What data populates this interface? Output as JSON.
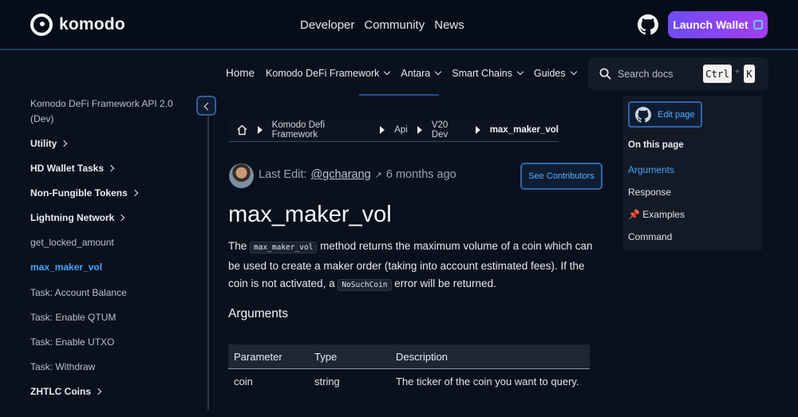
{
  "brand": {
    "name": "komodo"
  },
  "topnav": {
    "items": [
      "Developer",
      "Community",
      "News"
    ]
  },
  "launch_button": {
    "label": "Launch Wallet"
  },
  "docsnav": {
    "items": [
      {
        "label": "Home",
        "dropdown": false
      },
      {
        "label": "Komodo DeFi Framework",
        "dropdown": true
      },
      {
        "label": "Antara",
        "dropdown": true
      },
      {
        "label": "Smart Chains",
        "dropdown": true
      },
      {
        "label": "Guides",
        "dropdown": true
      }
    ]
  },
  "search": {
    "placeholder": "Search docs",
    "shortcut_key1": "Ctrl",
    "shortcut_plus": "+",
    "shortcut_key2": "K"
  },
  "sidebar": {
    "items": [
      {
        "label": "Komodo DeFi Framework API 2.0 (Dev)",
        "style": "normal",
        "expandable": false
      },
      {
        "label": "Utility",
        "style": "strong",
        "expandable": true
      },
      {
        "label": "HD Wallet Tasks",
        "style": "strong",
        "expandable": true
      },
      {
        "label": "Non-Fungible Tokens",
        "style": "strong",
        "expandable": true
      },
      {
        "label": "Lightning Network",
        "style": "strong",
        "expandable": true
      },
      {
        "label": "get_locked_amount",
        "style": "normal",
        "expandable": false
      },
      {
        "label": "max_maker_vol",
        "style": "active",
        "expandable": false
      },
      {
        "label": "Task: Account Balance",
        "style": "normal",
        "expandable": false
      },
      {
        "label": "Task: Enable QTUM",
        "style": "normal",
        "expandable": false
      },
      {
        "label": "Task: Enable UTXO",
        "style": "normal",
        "expandable": false
      },
      {
        "label": "Task: Withdraw",
        "style": "normal",
        "expandable": false
      },
      {
        "label": "ZHTLC Coins",
        "style": "strong",
        "expandable": true
      }
    ]
  },
  "breadcrumb": {
    "items": [
      "Komodo Defi Framework",
      "Api",
      "V20 Dev"
    ],
    "current": "max_maker_vol"
  },
  "last_edit": {
    "label": "Last Edit:",
    "user": "@gcharang",
    "arrow": "↗",
    "when": "6 months ago",
    "contributors_button": "See Contributors"
  },
  "page": {
    "title": "max_maker_vol",
    "intro_1": "The ",
    "intro_code_1": "max_maker_vol",
    "intro_2": " method returns the maximum volume of a coin which can be used to create a maker order (taking into account estimated fees). If the coin is not activated, a ",
    "intro_code_2": "NoSuchCoin",
    "intro_3": " error will be returned.",
    "section_arguments": "Arguments"
  },
  "arguments_table": {
    "headers": [
      "Parameter",
      "Type",
      "Description"
    ],
    "rows": [
      [
        "coin",
        "string",
        "The ticker of the coin you want to query."
      ]
    ]
  },
  "toc": {
    "edit_label": "Edit page",
    "title": "On this page",
    "items": [
      {
        "label": "Arguments",
        "active": true
      },
      {
        "label": "Response",
        "active": false
      },
      {
        "label": "📌 Examples",
        "active": false
      },
      {
        "label": "Command",
        "active": false
      }
    ]
  },
  "colors": {
    "accent": "#3ea6ff",
    "background": "#0a111d",
    "launch_gradient_start": "#6f4cf2",
    "launch_gradient_end": "#a13ef0"
  }
}
